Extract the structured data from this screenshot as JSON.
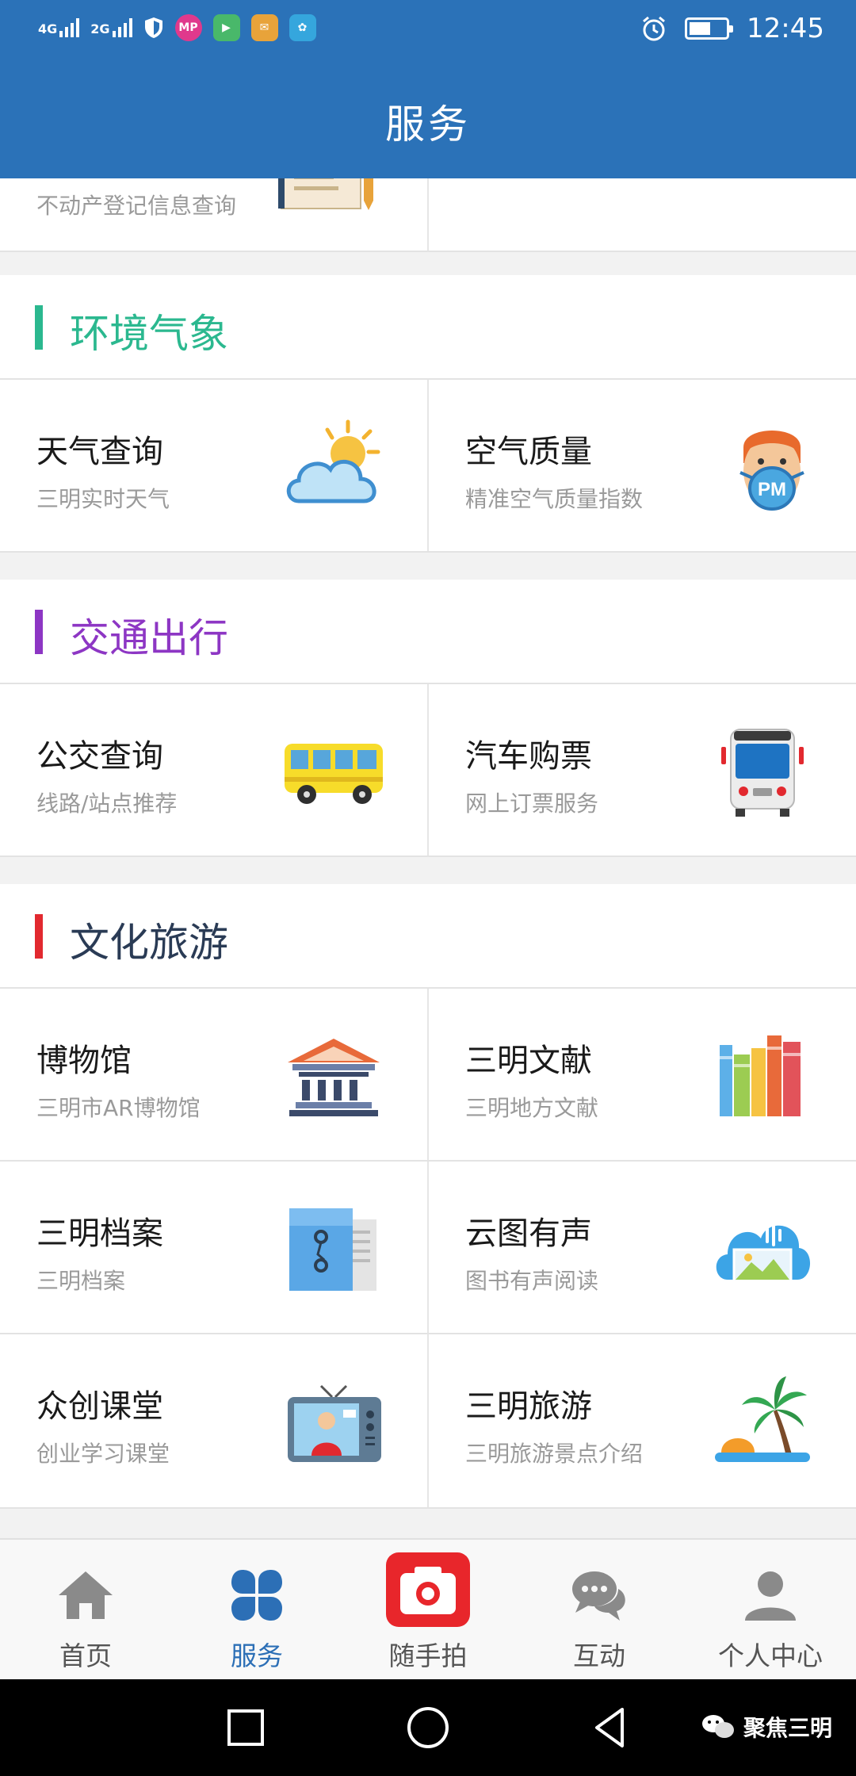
{
  "status_bar": {
    "network_1": "4G",
    "network_2": "2G",
    "apps": [
      {
        "name": "shield-app",
        "label": "",
        "color": "#ffffff"
      },
      {
        "name": "mp-app",
        "label": "MP",
        "color": "#e0398c"
      },
      {
        "name": "player-app",
        "label": "▶",
        "color": "#49b86a"
      },
      {
        "name": "mail-app",
        "label": "✉",
        "color": "#e8a33a"
      },
      {
        "name": "flower-app",
        "label": "✿",
        "color": "#35a6dd"
      }
    ],
    "battery_level": 0.6,
    "time": "12:45"
  },
  "header": {
    "title": "服务"
  },
  "partial_row": {
    "subtitle": "不动产登记信息查询"
  },
  "sections": [
    {
      "title": "环境气象",
      "accent": "#2bb88f",
      "items": [
        {
          "title": "天气查询",
          "subtitle": "三明实时天气",
          "icon": "weather-icon"
        },
        {
          "title": "空气质量",
          "subtitle": "精准空气质量指数",
          "icon": "air-mask-icon",
          "badge": "PM"
        }
      ]
    },
    {
      "title": "交通出行",
      "accent": "#8d36c4",
      "items": [
        {
          "title": "公交查询",
          "subtitle": "线路/站点推荐",
          "icon": "bus-side-icon"
        },
        {
          "title": "汽车购票",
          "subtitle": "网上订票服务",
          "icon": "bus-front-icon"
        }
      ]
    },
    {
      "title": "文化旅游",
      "accent": "#e2292f",
      "title_color": "#2a3b55",
      "items": [
        {
          "title": "博物馆",
          "subtitle": "三明市AR博物馆",
          "icon": "museum-icon"
        },
        {
          "title": "三明文献",
          "subtitle": "三明地方文献",
          "icon": "books-icon"
        },
        {
          "title": "三明档案",
          "subtitle": "三明档案",
          "icon": "archive-icon"
        },
        {
          "title": "云图有声",
          "subtitle": "图书有声阅读",
          "icon": "cloud-audio-icon"
        },
        {
          "title": "众创课堂",
          "subtitle": "创业学习课堂",
          "icon": "tv-icon"
        },
        {
          "title": "三明旅游",
          "subtitle": "三明旅游景点介绍",
          "icon": "palm-tree-icon"
        }
      ]
    }
  ],
  "tabs": [
    {
      "label": "首页",
      "icon": "home-icon"
    },
    {
      "label": "服务",
      "icon": "grid-icon",
      "active": true
    },
    {
      "label": "随手拍",
      "icon": "camera-icon"
    },
    {
      "label": "互动",
      "icon": "chat-icon"
    },
    {
      "label": "个人中心",
      "icon": "person-icon"
    }
  ],
  "watermark": {
    "text": "聚焦三明"
  },
  "colors": {
    "brand": "#2b72b8",
    "tab_active": "#2c6fb6",
    "camera_red": "#e8262b"
  }
}
